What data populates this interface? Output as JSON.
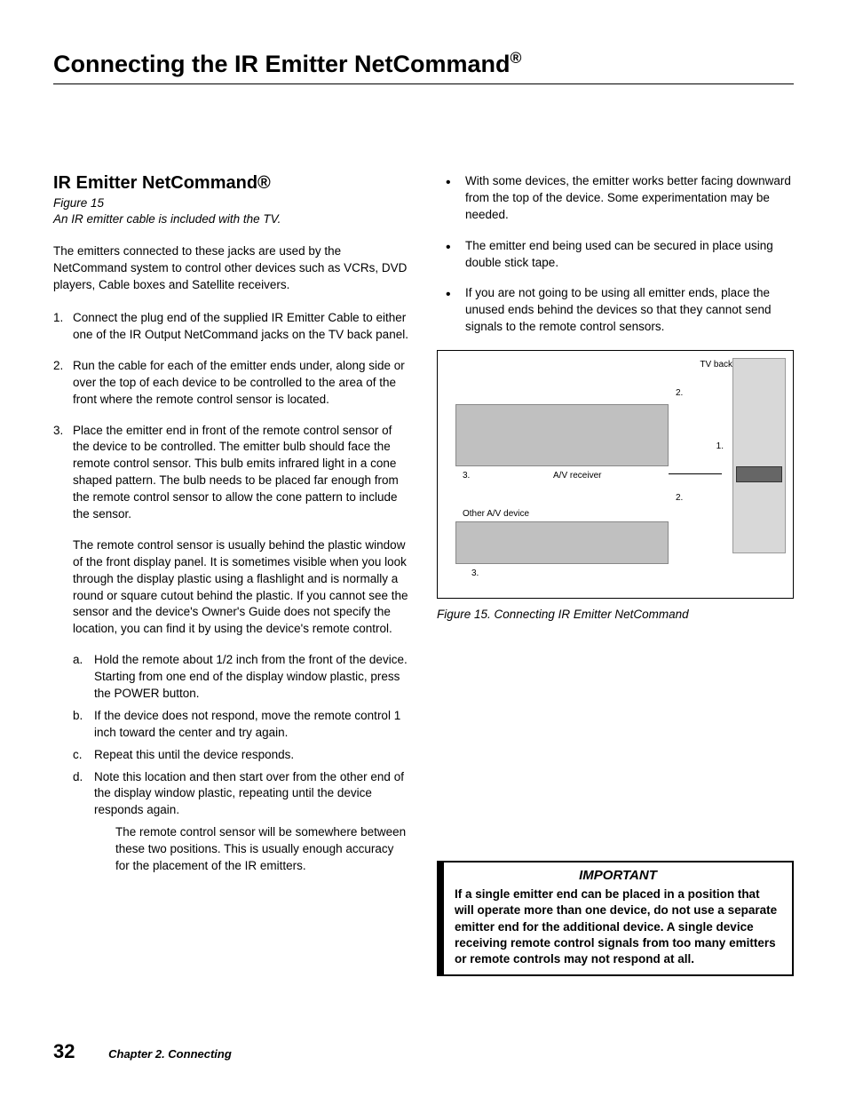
{
  "page_title_pre": "Connecting the IR Emitter NetCommand",
  "page_title_sup": "®",
  "section_heading": "IR Emitter NetCommand®",
  "figure_ref_line1": "Figure 15",
  "figure_ref_line2": "An IR emitter cable is included with the TV.",
  "intro": "The emitters connected to these jacks are used by the NetCommand system to control other devices such as VCRs, DVD players, Cable boxes and Satellite receivers.",
  "steps": {
    "s1": "Connect the plug end of the supplied IR Emitter Cable to either one of the IR Output NetCommand jacks on the TV back panel.",
    "s2": "Run the cable for each of the emitter ends under, along side or over the top of each device to be controlled to the area of the front where the remote control sensor is located.",
    "s3": "Place the emitter end in front of the remote control sensor of the device to be controlled.  The emitter bulb should face the remote control sensor.  This bulb emits infrared light in a cone shaped pattern.  The bulb needs to be placed far enough from the remote control sensor  to allow the cone pattern to include the sensor.",
    "s3_para": "The remote control sensor is usually behind the plastic window of the front display panel.  It is sometimes visible when you look through the display plastic using a flashlight and is normally a round or square cutout behind the plastic.  If you cannot see the sensor and the device's Owner's Guide does not specify the location, you can find it by using the device's remote control.",
    "sub": {
      "a": "Hold the remote about 1/2 inch from the front of the device.  Starting from one end of the display window plastic, press the POWER button.",
      "b": "If the device does not respond, move the remote control 1 inch toward the center and try again.",
      "c": "Repeat this until the device responds.",
      "d": "Note this location and then start over from the other end of the display window plastic, repeating until the device responds again.",
      "d_para": "The remote control sensor will be somewhere between these two positions.  This is usually enough accuracy for the placement of the IR emitters."
    }
  },
  "bullets": {
    "b1": "With some devices, the emitter works better facing downward from the top of the device.  Some experimentation may be needed.",
    "b2": "The emitter end being used can be secured in place using double stick tape.",
    "b3": "If you are not going to be using all emitter ends, place the unused ends behind the devices so that they cannot send signals to the remote control sensors."
  },
  "figure": {
    "tv_label": "TV back panel detail",
    "receiver_label": "A/V receiver",
    "other_label": "Other A/V device",
    "n1": "1.",
    "n2": "2.",
    "n3": "3.",
    "caption": "Figure 15.  Connecting IR Emitter NetCommand"
  },
  "important": {
    "title": "IMPORTANT",
    "text": "If a single emitter end can be placed in a position that will operate more than one device, do not use a separate emitter end for the additional device.  A single device receiving remote control signals from too many emitters or remote controls may not  respond at all."
  },
  "footer": {
    "page": "32",
    "chapter": "Chapter 2.  Connecting"
  }
}
